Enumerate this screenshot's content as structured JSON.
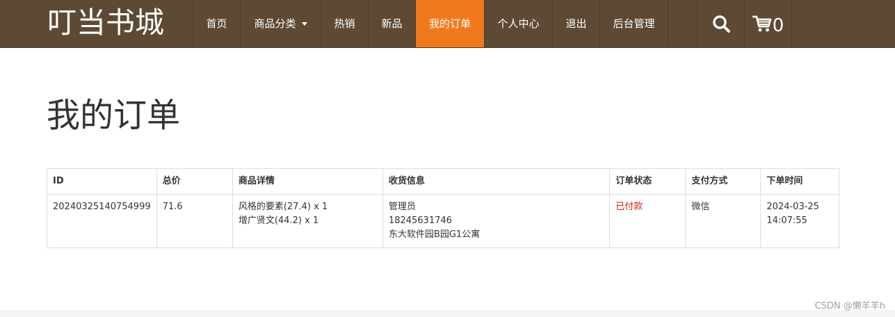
{
  "brand": "叮当书城",
  "nav": {
    "items": [
      {
        "label": "首页"
      },
      {
        "label": "商品分类"
      },
      {
        "label": "热销"
      },
      {
        "label": "新品"
      },
      {
        "label": "我的订单"
      },
      {
        "label": "个人中心"
      },
      {
        "label": "退出"
      },
      {
        "label": "后台管理"
      }
    ],
    "active_item": "我的订单",
    "cart_count": "0"
  },
  "page_title": "我的订单",
  "orders_table": {
    "headers": [
      "ID",
      "总价",
      "商品详情",
      "收货信息",
      "订单状态",
      "支付方式",
      "下单时间"
    ],
    "rows": [
      {
        "id": "20240325140754999",
        "total": "71.6",
        "items": [
          "风格的要素(27.4) x 1",
          "增广贤文(44.2) x 1"
        ],
        "shipping": [
          "管理员",
          "18245631746",
          "东大软件园B园G1公寓"
        ],
        "status": "已付款",
        "payment": "微信",
        "order_time": [
          "2024-03-25",
          "14:07:55"
        ]
      }
    ]
  },
  "watermark": "CSDN @懒羊羊h",
  "colors": {
    "navbar_bg": "#5e4a34",
    "active_tab": "#f0791e",
    "status_paid": "#d81e06"
  },
  "icons": {
    "search": "search-icon",
    "cart": "cart-icon",
    "dropdown": "caret-down-icon"
  }
}
